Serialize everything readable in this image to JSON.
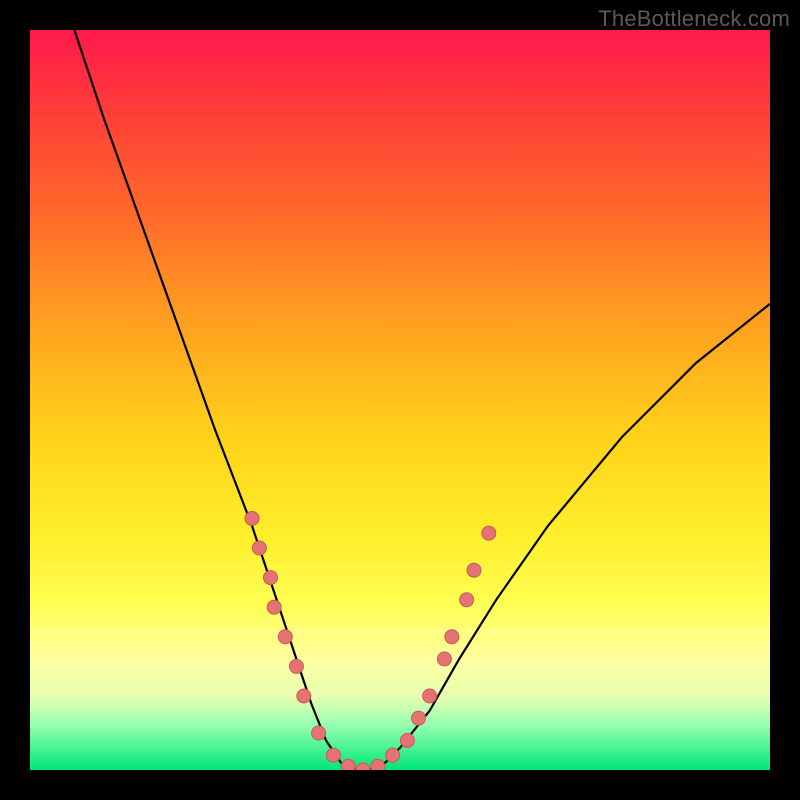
{
  "watermark": "TheBottleneck.com",
  "colors": {
    "background": "#000000",
    "curve": "#000000",
    "dot_fill": "#e57373",
    "dot_stroke": "#c85a5a"
  },
  "chart_data": {
    "type": "line",
    "title": "",
    "xlabel": "",
    "ylabel": "",
    "xlim": [
      0,
      100
    ],
    "ylim": [
      0,
      100
    ],
    "series": [
      {
        "name": "bottleneck-curve",
        "x": [
          6,
          10,
          15,
          20,
          25,
          30,
          33,
          36,
          38,
          40,
          42,
          44,
          46,
          48,
          50,
          54,
          58,
          63,
          70,
          80,
          90,
          100
        ],
        "y": [
          100,
          88,
          74,
          60,
          46,
          33,
          24,
          15,
          9,
          4,
          1,
          0,
          0,
          1,
          3,
          8,
          15,
          23,
          33,
          45,
          55,
          63
        ]
      }
    ],
    "annotations_dots": [
      {
        "x": 30,
        "y": 34
      },
      {
        "x": 31,
        "y": 30
      },
      {
        "x": 32.5,
        "y": 26
      },
      {
        "x": 33,
        "y": 22
      },
      {
        "x": 34.5,
        "y": 18
      },
      {
        "x": 36,
        "y": 14
      },
      {
        "x": 37,
        "y": 10
      },
      {
        "x": 39,
        "y": 5
      },
      {
        "x": 41,
        "y": 2
      },
      {
        "x": 43,
        "y": 0.5
      },
      {
        "x": 45,
        "y": 0
      },
      {
        "x": 47,
        "y": 0.5
      },
      {
        "x": 49,
        "y": 2
      },
      {
        "x": 51,
        "y": 4
      },
      {
        "x": 52.5,
        "y": 7
      },
      {
        "x": 54,
        "y": 10
      },
      {
        "x": 56,
        "y": 15
      },
      {
        "x": 57,
        "y": 18
      },
      {
        "x": 59,
        "y": 23
      },
      {
        "x": 60,
        "y": 27
      },
      {
        "x": 62,
        "y": 32
      }
    ]
  }
}
